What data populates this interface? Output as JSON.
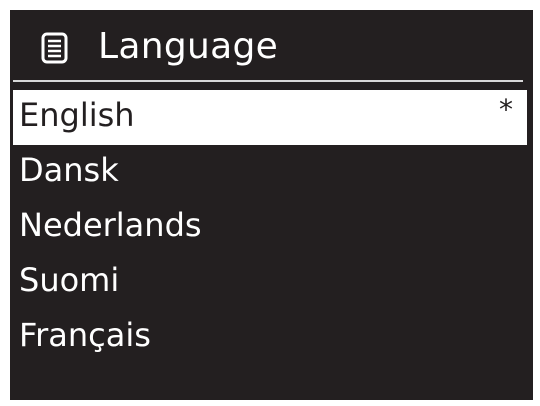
{
  "header": {
    "title": "Language",
    "icon": "list-menu-icon"
  },
  "languages": [
    {
      "label": "English",
      "selected": true,
      "marker": "*"
    },
    {
      "label": "Dansk",
      "selected": false
    },
    {
      "label": "Nederlands",
      "selected": false
    },
    {
      "label": "Suomi",
      "selected": false
    },
    {
      "label": "Français",
      "selected": false
    }
  ],
  "colors": {
    "background": "#231f20",
    "foreground": "#ffffff",
    "highlight": "#ffffff"
  }
}
